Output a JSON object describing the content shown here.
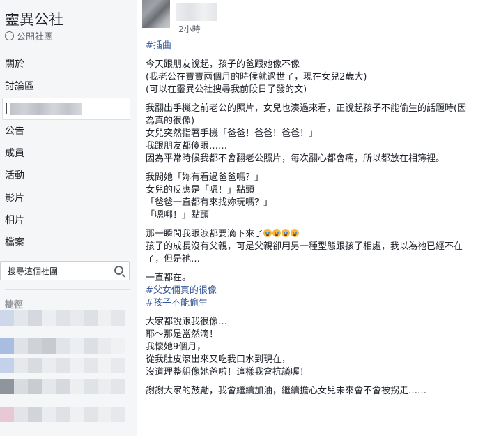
{
  "group": {
    "name": "靈異公社",
    "privacy": "公開社團"
  },
  "sidebar": {
    "items": [
      {
        "label": "關於"
      },
      {
        "label": "討論區"
      },
      {
        "label": "公告"
      },
      {
        "label": "成員"
      },
      {
        "label": "活動"
      },
      {
        "label": "影片"
      },
      {
        "label": "相片"
      },
      {
        "label": "檔案"
      }
    ],
    "search_placeholder": "搜尋這個社團",
    "shortcuts_title": "捷徑"
  },
  "post": {
    "timestamp": "2小時",
    "tag_top": "#插曲",
    "paragraph1": "今天跟朋友說起，孩子的爸跟她像不像\n(我老公在寶寶兩個月的時候就過世了，現在女兒2歲大)\n(可以在靈異公社搜尋我前段日子發的文)",
    "paragraph2": "我翻出手機之前老公的照片，女兒也湊過來看，正說起孩子不能偷生的話題時(因為真的很像)\n女兒突然指著手機「爸爸！爸爸！爸爸！」\n我跟朋友都傻眼……\n因為平常時候我都不會翻老公照片，每次翻心都會痛，所以都放在相簿裡。",
    "paragraph3": "我問她「妳有看過爸爸嗎？」\n女兒的反應是「嗯！」點頭\n「爸爸一直都有來找妳玩嗎？」\n「嗯哪！」點頭",
    "paragraph4_line1": "那一瞬間我眼淚都要滴下來了",
    "paragraph4_rest": "孩子的成長沒有父親，可是父親卻用另一種型態跟孩子相處，我以為祂已經不在了，但是祂…",
    "paragraph5": "一直都在。",
    "tag_1": "#父女倆真的很像",
    "tag_2": "#孩子不能偷生",
    "paragraph6": "大家都說跟我很像…\n耶～那是當然滴！\n我懷她9個月，\n從我肚皮滾出來又吃我口水到現在，\n沒道理整組像她爸啦！這樣我會抗議喔！",
    "paragraph7": "謝謝大家的鼓勵，我會繼續加油，繼續擔心女兒未來會不會被拐走……"
  },
  "colors": {
    "link": "#365899",
    "sidebar_bg": "#f5f6f7",
    "text": "#1d2129",
    "muted": "#616770"
  }
}
